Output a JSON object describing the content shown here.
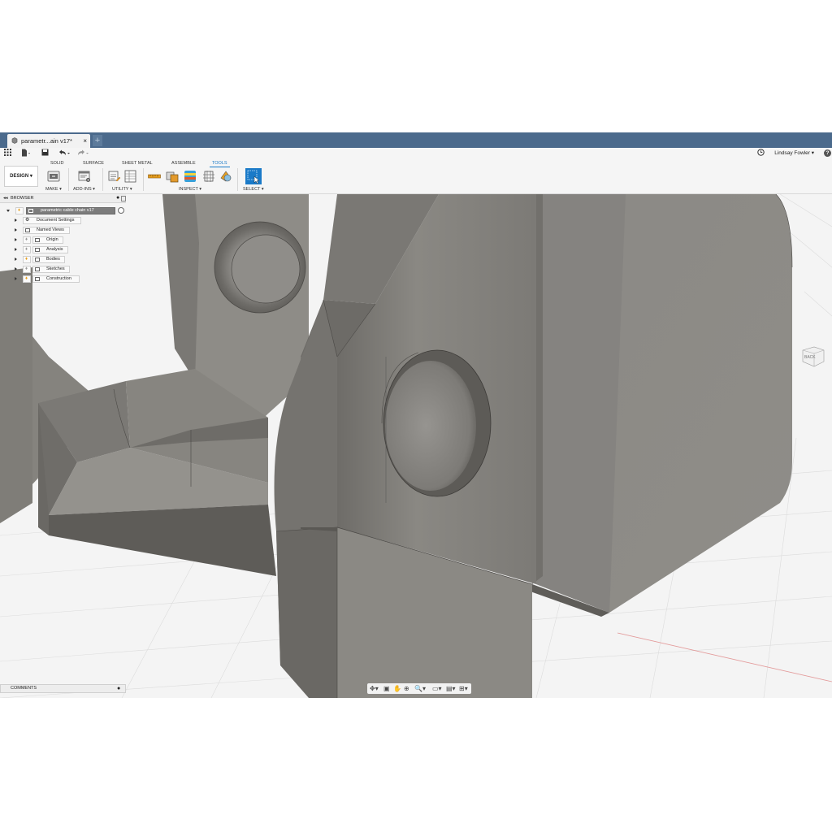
{
  "document_tab": {
    "title": "parametr...ain v17*",
    "close": "×",
    "new_tab": "+"
  },
  "quick_access": {
    "icons": [
      "apps-grid-icon",
      "file-icon",
      "save-icon",
      "undo-icon",
      "redo-icon"
    ],
    "user": "Lindsay Fowler ▾",
    "help": "?"
  },
  "ribbon": {
    "workspace": "DESIGN ▾",
    "tabs": [
      "SOLID",
      "SURFACE",
      "SHEET METAL",
      "ASSEMBLE",
      "TOOLS"
    ],
    "active_tab": "TOOLS",
    "groups": {
      "make": "MAKE ▾",
      "addins": "ADD-INS ▾",
      "utility": "UTILITY ▾",
      "inspect": "INSPECT ▾",
      "select": "SELECT ▾"
    }
  },
  "browser": {
    "title": "BROWSER",
    "root": "parametric cable chain v17",
    "items": [
      "Document Settings",
      "Named Views",
      "Origin",
      "Analysis",
      "Bodies",
      "Sketches",
      "Construction"
    ]
  },
  "comments": {
    "title": "COMMENTS"
  },
  "viewcube": {
    "face": "BACK"
  },
  "colors": {
    "title_bar": "#4b6a8c",
    "accent": "#1a7ac8",
    "model": "#8a8781",
    "grid_background": "#f4f4f4"
  }
}
